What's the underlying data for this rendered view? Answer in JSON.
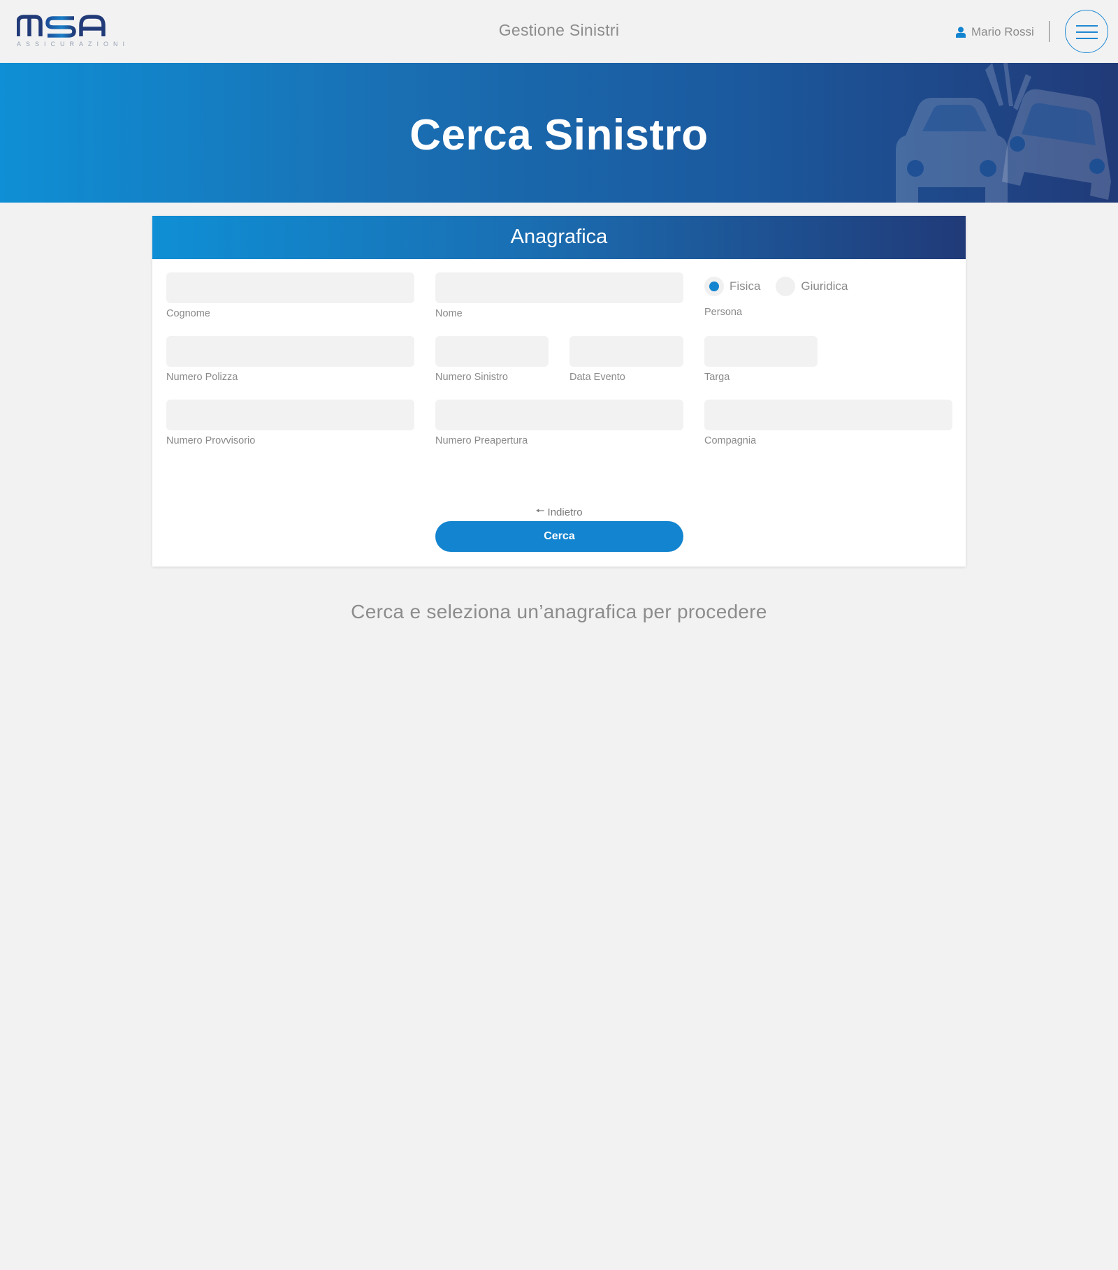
{
  "header": {
    "logo_text": "MSA",
    "logo_subtitle": "ASSICURAZIONI",
    "app_title": "Gestione Sinistri",
    "user_name": "Mario Rossi",
    "user_icon": "user-icon",
    "menu_icon": "hamburger-menu-icon"
  },
  "hero": {
    "title": "Cerca Sinistro",
    "illustration": "car-crash-icon"
  },
  "form": {
    "section_title": "Anagrafica",
    "fields": {
      "cognome": {
        "label": "Cognome",
        "value": ""
      },
      "nome": {
        "label": "Nome",
        "value": ""
      },
      "numero_polizza": {
        "label": "Numero Polizza",
        "value": ""
      },
      "numero_sinistro": {
        "label": "Numero Sinistro",
        "value": ""
      },
      "data_evento": {
        "label": "Data Evento",
        "value": ""
      },
      "targa": {
        "label": "Targa",
        "value": ""
      },
      "numero_provvisorio": {
        "label": "Numero Provvisorio",
        "value": ""
      },
      "numero_preapertura": {
        "label": "Numero Preapertura",
        "value": ""
      },
      "compagnia": {
        "label": "Compagnia",
        "value": ""
      }
    },
    "persona": {
      "label": "Persona",
      "options": [
        "Fisica",
        "Giuridica"
      ],
      "selected": "Fisica"
    },
    "back_label": "Indietro",
    "submit_label": "Cerca"
  },
  "hint": "Cerca e seleziona un’anagrafica per procedere",
  "colors": {
    "accent": "#1384cf",
    "brand_dark": "#213a78",
    "background": "#f2f2f2"
  }
}
